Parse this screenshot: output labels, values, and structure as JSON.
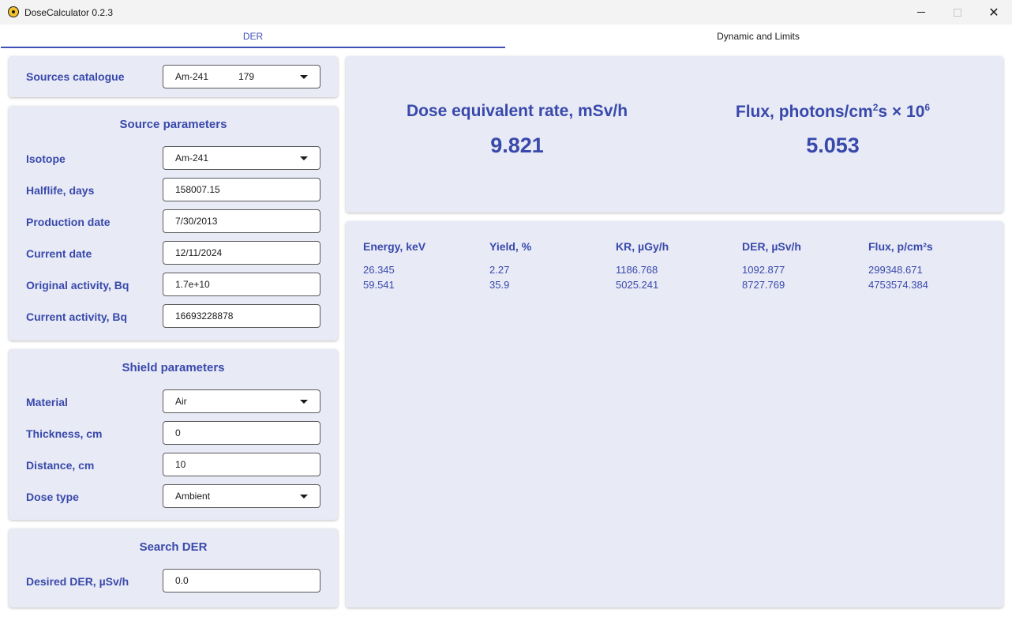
{
  "window": {
    "title": "DoseCalculator 0.2.3",
    "close_glyph": "✕"
  },
  "tabs": [
    {
      "label": "DER"
    },
    {
      "label": "Dynamic and Limits"
    }
  ],
  "sources_catalogue": {
    "label": "Sources catalogue",
    "value": "Am-241",
    "sub_value": "179"
  },
  "source_parameters": {
    "title": "Source parameters",
    "isotope": {
      "label": "Isotope",
      "value": "Am-241"
    },
    "halflife": {
      "label": "Halflife, days",
      "value": "158007.15"
    },
    "production_date": {
      "label": "Production date",
      "value": "7/30/2013"
    },
    "current_date": {
      "label": "Current date",
      "value": "12/11/2024"
    },
    "original_activity": {
      "label": "Original activity, Bq",
      "value": "1.7e+10"
    },
    "current_activity": {
      "label": "Current activity, Bq",
      "value": "16693228878"
    }
  },
  "shield_parameters": {
    "title": "Shield parameters",
    "material": {
      "label": "Material",
      "value": "Air"
    },
    "thickness": {
      "label": "Thickness, cm",
      "value": "0"
    },
    "distance": {
      "label": "Distance, cm",
      "value": "10"
    },
    "dose_type": {
      "label": "Dose type",
      "value": "Ambient"
    }
  },
  "search_der": {
    "title": "Search DER",
    "desired": {
      "label": "Desired DER, µSv/h",
      "value": "0.0"
    }
  },
  "results": {
    "der_label": "Dose equivalent rate, mSv/h",
    "der_value": "9.821",
    "flux_label": "Flux, photons/cm",
    "flux_label_sup1": "2",
    "flux_label_mid": "s × 10",
    "flux_label_sup2": "6",
    "flux_value": "5.053"
  },
  "table": {
    "headers": [
      "Energy, keV",
      "Yield, %",
      "KR, µGy/h",
      "DER, µSv/h",
      "Flux, p/cm²s"
    ],
    "rows": [
      [
        "26.345",
        "2.27",
        "1186.768",
        "1092.877",
        "299348.671"
      ],
      [
        "59.541",
        "35.9",
        "5025.241",
        "8727.769",
        "4753574.384"
      ]
    ]
  },
  "icons": [
    "radiation-app-icon",
    "minimize-icon",
    "maximize-icon",
    "close-icon",
    "chevron-down-icon"
  ],
  "colors": {
    "accent": "#3f51b5",
    "text": "#3949ab",
    "card": "#e8eaf6"
  }
}
